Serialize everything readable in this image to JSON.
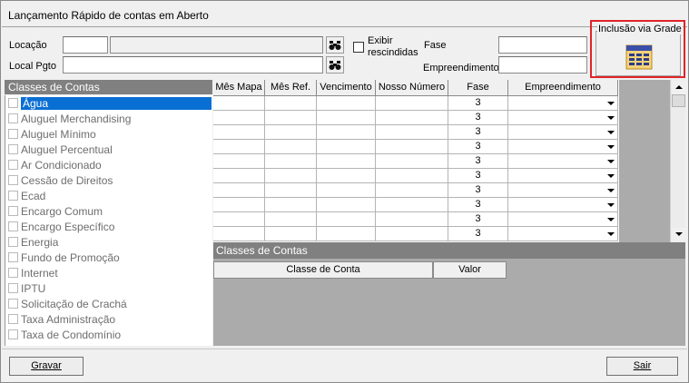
{
  "window": {
    "title": "Lançamento Rápido de contas em Aberto"
  },
  "filters": {
    "locacao_label": "Locação",
    "local_pgto_label": "Local Pgto",
    "exibir_label_line1": "Exibir",
    "exibir_label_line2": "rescindidas",
    "fase_label": "Fase",
    "empreendimento_label": "Empreendimento",
    "locacao_code": "",
    "locacao_name": "",
    "local_pgto_value": "",
    "fase_value": "",
    "empreendimento_value": ""
  },
  "grade": {
    "legend": "Inclusão via Grade",
    "icon": "grid-table-icon"
  },
  "classes_panel": {
    "title": "Classes de Contas",
    "items": [
      "Água",
      "Aluguel Merchandising",
      "Aluguel Mínimo",
      "Aluguel Percentual",
      "Ar Condicionado",
      "Cessão de Direitos",
      "Ecad",
      "Encargo Comum",
      "Encargo Específico",
      "Energia",
      "Fundo de Promoção",
      "Internet",
      "IPTU",
      "Solicitação de Crachá",
      "Taxa Administração",
      "Taxa de Condomínio"
    ],
    "selected_index": 0
  },
  "grid": {
    "columns": [
      "Mês Mapa",
      "Mês Ref.",
      "Vencimento",
      "Nosso Número",
      "Fase",
      "Empreendimento"
    ],
    "rows": [
      {
        "fase": "3"
      },
      {
        "fase": "3"
      },
      {
        "fase": "3"
      },
      {
        "fase": "3"
      },
      {
        "fase": "3"
      },
      {
        "fase": "3"
      },
      {
        "fase": "3"
      },
      {
        "fase": "3"
      },
      {
        "fase": "3"
      },
      {
        "fase": "3"
      }
    ]
  },
  "lower_panel": {
    "title": "Classes de Contas",
    "columns": [
      "Classe de Conta",
      "Valor"
    ]
  },
  "buttons": {
    "gravar": "Gravar",
    "sair": "Sair"
  }
}
